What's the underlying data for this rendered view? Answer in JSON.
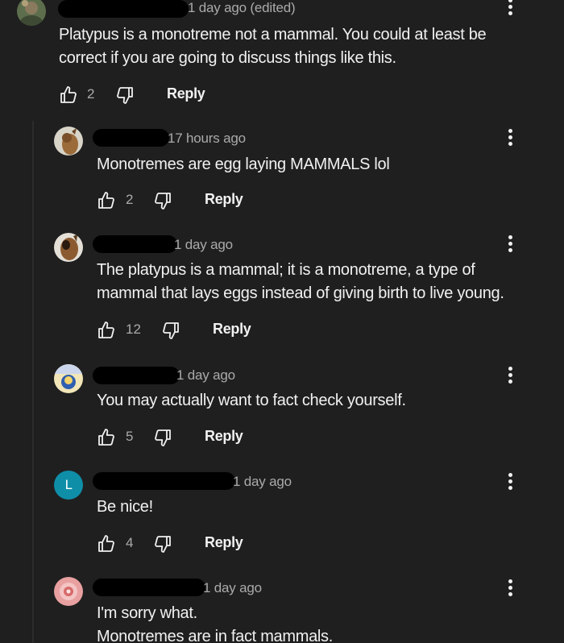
{
  "colors": {
    "background": "#1f1f1f",
    "text_primary": "#f1f1f1",
    "text_secondary": "#aaaaaa",
    "avatar_letter_bg": "#0f8ea8"
  },
  "comments": [
    {
      "timestamp": "1 day ago (edited)",
      "text": "Platypus is a monotreme not a mammal. You could at least be\ncorrect if you are going to discuss things like this.",
      "likes": "2",
      "reply_label": "Reply"
    },
    {
      "timestamp": "17 hours ago",
      "text": "Monotremes are egg laying MAMMALS lol",
      "likes": "2",
      "reply_label": "Reply"
    },
    {
      "timestamp": "1 day ago",
      "text": "The platypus is a mammal; it is a monotreme, a type of\nmammal that lays eggs instead of giving birth to live young.",
      "likes": "12",
      "reply_label": "Reply"
    },
    {
      "timestamp": "1 day ago",
      "text": "You may actually want to fact check yourself.",
      "likes": "5",
      "reply_label": "Reply"
    },
    {
      "avatar_letter": "L",
      "timestamp": "1 day ago",
      "text": "Be nice!",
      "likes": "4",
      "reply_label": "Reply"
    },
    {
      "timestamp": "1 day ago",
      "text": "I'm sorry what.\nMonotremes are in fact mammals."
    }
  ],
  "icons": {
    "like": "thumbs-up-icon",
    "dislike": "thumbs-down-icon",
    "menu": "more-vert-icon"
  }
}
